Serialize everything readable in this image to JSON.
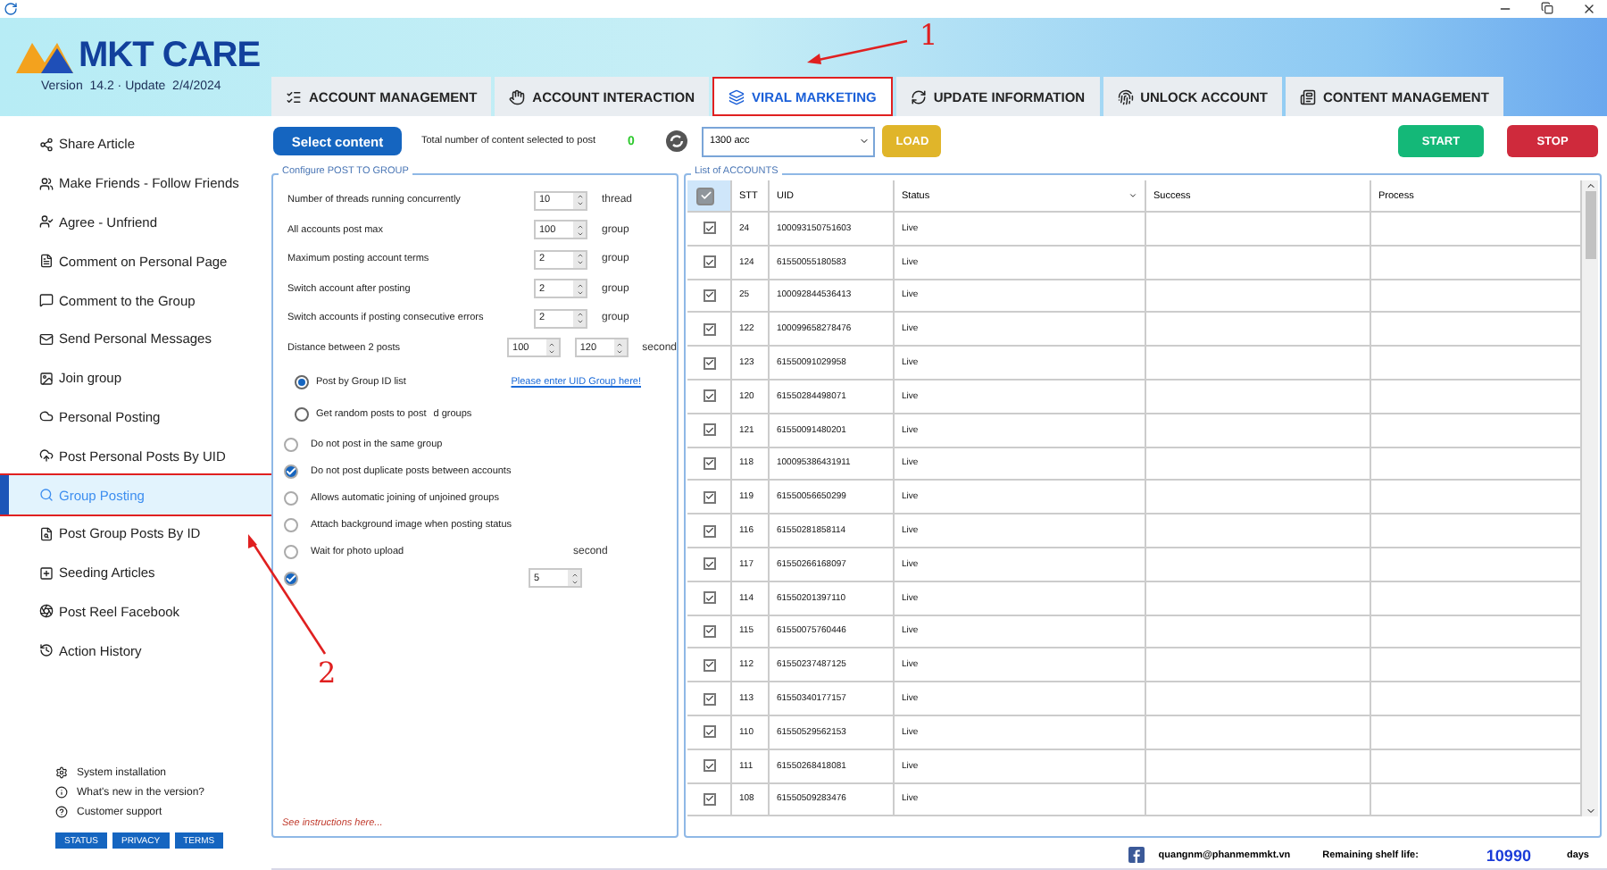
{
  "header": {
    "logo_text": "MKT CARE",
    "version": "Version  14.2 · Update  2/4/2024"
  },
  "tabs": [
    {
      "label": "ACCOUNT MANAGEMENT",
      "selected": false,
      "highlighted": false
    },
    {
      "label": "ACCOUNT INTERACTION",
      "selected": false,
      "highlighted": false
    },
    {
      "label": "VIRAL MARKETING",
      "selected": true,
      "highlighted": true
    },
    {
      "label": "UPDATE INFORMATION",
      "selected": false,
      "highlighted": false
    },
    {
      "label": "UNLOCK ACCOUNT",
      "selected": false,
      "highlighted": false
    },
    {
      "label": "CONTENT MANAGEMENT",
      "selected": false,
      "highlighted": false
    }
  ],
  "sidebar": {
    "items": [
      {
        "label": "Share Article",
        "selected": false,
        "highlighted": false
      },
      {
        "label": "Make Friends - Follow Friends",
        "selected": false,
        "highlighted": false
      },
      {
        "label": "Agree - Unfriend",
        "selected": false,
        "highlighted": false
      },
      {
        "label": "Comment on Personal Page",
        "selected": false,
        "highlighted": false
      },
      {
        "label": "Comment to the Group",
        "selected": false,
        "highlighted": false
      },
      {
        "label": "Send Personal Messages",
        "selected": false,
        "highlighted": false
      },
      {
        "label": "Join group",
        "selected": false,
        "highlighted": false
      },
      {
        "label": "Personal Posting",
        "selected": false,
        "highlighted": false
      },
      {
        "label": "Post Personal Posts By UID",
        "selected": false,
        "highlighted": false
      },
      {
        "label": "Group Posting",
        "selected": true,
        "highlighted": true
      },
      {
        "label": "Post Group Posts By ID",
        "selected": false,
        "highlighted": false
      },
      {
        "label": "Seeding Articles",
        "selected": false,
        "highlighted": false
      },
      {
        "label": "Post Reel Facebook",
        "selected": false,
        "highlighted": false
      },
      {
        "label": "Action History",
        "selected": false,
        "highlighted": false
      }
    ],
    "links": [
      "System installation",
      "What's new in the version?",
      "Customer support"
    ],
    "badges": [
      "STATUS",
      "PRIVACY",
      "TERMS"
    ]
  },
  "toolbar": {
    "select_button": "Select content",
    "total_label": "Total number of content selected to post",
    "total_count": "0",
    "account_select": "1300 acc",
    "load_button": "LOAD",
    "start_button": "START",
    "stop_button": "STOP"
  },
  "config": {
    "title": "Configure POST TO GROUP",
    "fields": [
      {
        "label": "Number of threads running concurrently",
        "values": [
          "10"
        ],
        "unit": "thread"
      },
      {
        "label": "All accounts post max",
        "values": [
          "100"
        ],
        "unit": "group"
      },
      {
        "label": "Maximum posting account terms",
        "values": [
          "2"
        ],
        "unit": "group"
      },
      {
        "label": "Switch account after posting",
        "values": [
          "2"
        ],
        "unit": "group"
      },
      {
        "label": "Switch accounts if posting consecutive errors",
        "values": [
          "2"
        ],
        "unit": "group"
      },
      {
        "label": "Distance between 2 posts",
        "values": [
          "100",
          "120"
        ],
        "unit": "second"
      }
    ],
    "radios": [
      {
        "label": "Post by Group ID list",
        "selected": true,
        "link": "Please enter UID Group here!"
      },
      {
        "label": "Get random posts to post",
        "selected": false,
        "suffix": "d groups"
      }
    ],
    "checkboxes": [
      {
        "label": "Do not post in the same group",
        "checked": false
      },
      {
        "label": "Do not post duplicate posts between accounts",
        "checked": true
      },
      {
        "label": "Allows automatic joining of unjoined groups",
        "checked": false
      },
      {
        "label": "Attach background image when posting status",
        "checked": false
      },
      {
        "label": "Wait for photo upload",
        "checked": false,
        "unit": "second"
      },
      {
        "checked": true,
        "value": "5"
      }
    ],
    "note": "See instructions here..."
  },
  "accounts": {
    "title": "List of ACCOUNTS",
    "header_checked": true,
    "columns": [
      "STT",
      "UID",
      "Status",
      "Success",
      "Process"
    ],
    "rows": [
      {
        "checked": true,
        "stt": "24",
        "uid": "100093150751603",
        "status": "Live"
      },
      {
        "checked": true,
        "stt": "124",
        "uid": "61550055180583",
        "status": "Live"
      },
      {
        "checked": true,
        "stt": "25",
        "uid": "100092844536413",
        "status": "Live"
      },
      {
        "checked": true,
        "stt": "122",
        "uid": "100099658278476",
        "status": "Live"
      },
      {
        "checked": true,
        "stt": "123",
        "uid": "61550091029958",
        "status": "Live"
      },
      {
        "checked": true,
        "stt": "120",
        "uid": "61550284498071",
        "status": "Live"
      },
      {
        "checked": true,
        "stt": "121",
        "uid": "61550091480201",
        "status": "Live"
      },
      {
        "checked": true,
        "stt": "118",
        "uid": "100095386431911",
        "status": "Live"
      },
      {
        "checked": true,
        "stt": "119",
        "uid": "61550056650299",
        "status": "Live"
      },
      {
        "checked": true,
        "stt": "116",
        "uid": "61550281858114",
        "status": "Live"
      },
      {
        "checked": true,
        "stt": "117",
        "uid": "61550266168097",
        "status": "Live"
      },
      {
        "checked": true,
        "stt": "114",
        "uid": "61550201397110",
        "status": "Live"
      },
      {
        "checked": true,
        "stt": "115",
        "uid": "61550075760446",
        "status": "Live"
      },
      {
        "checked": true,
        "stt": "112",
        "uid": "61550237487125",
        "status": "Live"
      },
      {
        "checked": true,
        "stt": "113",
        "uid": "61550340177157",
        "status": "Live"
      },
      {
        "checked": true,
        "stt": "110",
        "uid": "61550529562153",
        "status": "Live"
      },
      {
        "checked": true,
        "stt": "111",
        "uid": "61550268418081",
        "status": "Live"
      },
      {
        "checked": true,
        "stt": "108",
        "uid": "61550509283476",
        "status": "Live"
      }
    ]
  },
  "status_bar": {
    "email": "quangnm@phanmemmkt.vn",
    "shelf_label": "Remaining shelf life:",
    "days_count": "10990",
    "days_unit": "days"
  },
  "annotations": [
    {
      "label": "1"
    },
    {
      "label": "2"
    }
  ]
}
